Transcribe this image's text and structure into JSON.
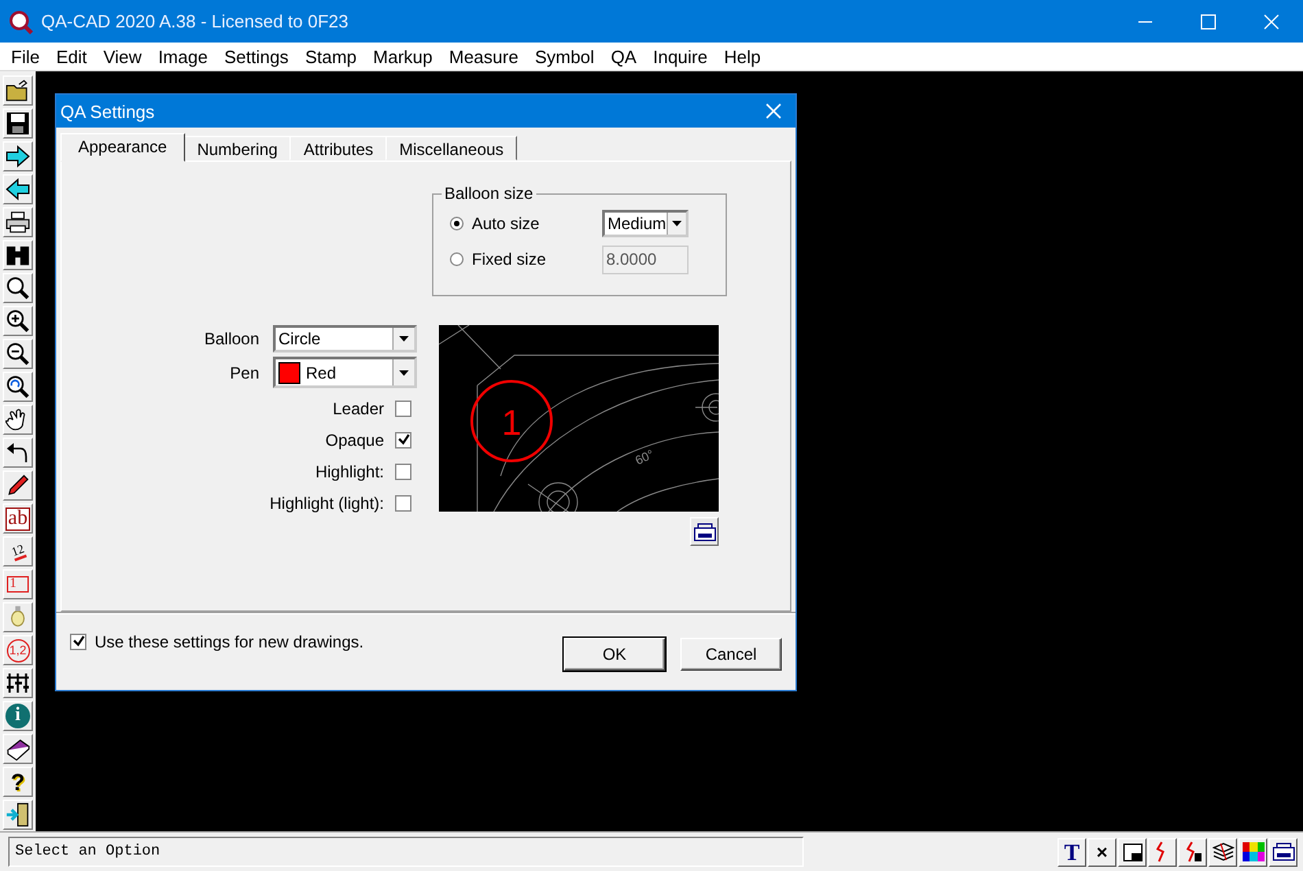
{
  "window": {
    "title": "QA-CAD 2020 A.38 - Licensed to 0F23"
  },
  "menu": [
    "File",
    "Edit",
    "View",
    "Image",
    "Settings",
    "Stamp",
    "Markup",
    "Measure",
    "Symbol",
    "QA",
    "Inquire",
    "Help"
  ],
  "toolbar": [
    {
      "kind": "open"
    },
    {
      "kind": "save"
    },
    {
      "kind": "forward"
    },
    {
      "kind": "back"
    },
    {
      "kind": "print"
    },
    {
      "kind": "binoculars"
    },
    {
      "kind": "zoom"
    },
    {
      "kind": "zoom-in"
    },
    {
      "kind": "zoom-out"
    },
    {
      "kind": "zoom-previous"
    },
    {
      "kind": "hand"
    },
    {
      "kind": "undo"
    },
    {
      "kind": "pencil"
    },
    {
      "kind": "text",
      "glyph": "ab"
    },
    {
      "kind": "dimension",
      "glyph": "12"
    },
    {
      "kind": "list",
      "glyph": "1"
    },
    {
      "kind": "bulb"
    },
    {
      "kind": "balloon",
      "glyph": "1,2"
    },
    {
      "kind": "sliders"
    },
    {
      "kind": "info",
      "glyph": "i"
    },
    {
      "kind": "book"
    },
    {
      "kind": "help",
      "glyph": "?"
    },
    {
      "kind": "exit"
    }
  ],
  "dialog": {
    "title": "QA Settings",
    "tabs": [
      {
        "label": "Appearance",
        "selected": true
      },
      {
        "label": "Numbering",
        "selected": false
      },
      {
        "label": "Attributes",
        "selected": false
      },
      {
        "label": "Miscellaneous",
        "selected": false
      }
    ],
    "balloon_size": {
      "legend": "Balloon size",
      "options": [
        {
          "label": "Auto size",
          "selected": true,
          "kind": "dropdown",
          "value": "Medium"
        },
        {
          "label": "Fixed size",
          "selected": false,
          "kind": "input",
          "value": "8.0000"
        }
      ]
    },
    "balloon": {
      "label": "Balloon",
      "value": "Circle"
    },
    "pen": {
      "label": "Pen",
      "value": "Red",
      "color": "#ff0000"
    },
    "checkboxes": [
      {
        "label": "Leader",
        "checked": false
      },
      {
        "label": "Opaque",
        "checked": true
      },
      {
        "label": "Highlight:",
        "checked": false
      },
      {
        "label": "Highlight (light):",
        "checked": false
      }
    ],
    "preview": {
      "balloon_number": "1",
      "angle_label": "60°"
    },
    "use_for_new": {
      "label": "Use these settings for new drawings.",
      "checked": true
    },
    "buttons": [
      "OK",
      "Cancel"
    ]
  },
  "status_bar": {
    "text": "Select an Option",
    "tools": [
      {
        "kind": "text",
        "glyph": "T"
      },
      {
        "kind": "delete",
        "glyph": "×"
      },
      {
        "kind": "window"
      },
      {
        "kind": "bolt"
      },
      {
        "kind": "bolt-block"
      },
      {
        "kind": "layers"
      },
      {
        "kind": "colors"
      },
      {
        "kind": "preview"
      }
    ]
  }
}
